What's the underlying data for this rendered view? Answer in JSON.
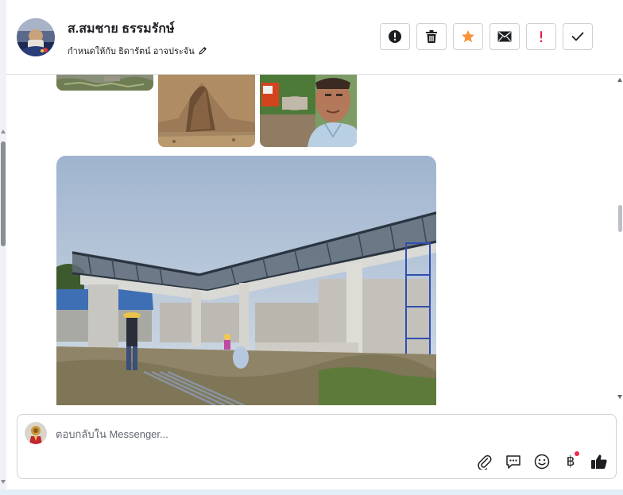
{
  "contact": {
    "name": "ส.สมชาย ธรรมรักษ์",
    "assigned_to": "กำหนดให้กับ ธิดารัตน์ อาจประจัน"
  },
  "actions": [
    {
      "name": "mark-spam-button",
      "icon": "alert-circle-icon",
      "color": "#1c1e21"
    },
    {
      "name": "delete-button",
      "icon": "trash-icon",
      "color": "#1c1e21"
    },
    {
      "name": "star-button",
      "icon": "star-icon",
      "color": "#f7923b"
    },
    {
      "name": "email-button",
      "icon": "envelope-icon",
      "color": "#1c1e21"
    },
    {
      "name": "follow-up-button",
      "icon": "exclamation-icon",
      "color": "#e41e3f"
    },
    {
      "name": "mark-done-button",
      "icon": "check-icon",
      "color": "#1c1e21"
    }
  ],
  "composer": {
    "placeholder": "ตอบกลับใน Messenger..."
  },
  "composer_tools": [
    "attachment-icon",
    "saved-reply-icon",
    "emoji-icon",
    "payment-icon",
    "like-icon"
  ],
  "colors": {
    "star": "#f7923b",
    "follow_up": "#e41e3f",
    "notification_dot": "#f02849",
    "border": "#ccd0d5"
  }
}
